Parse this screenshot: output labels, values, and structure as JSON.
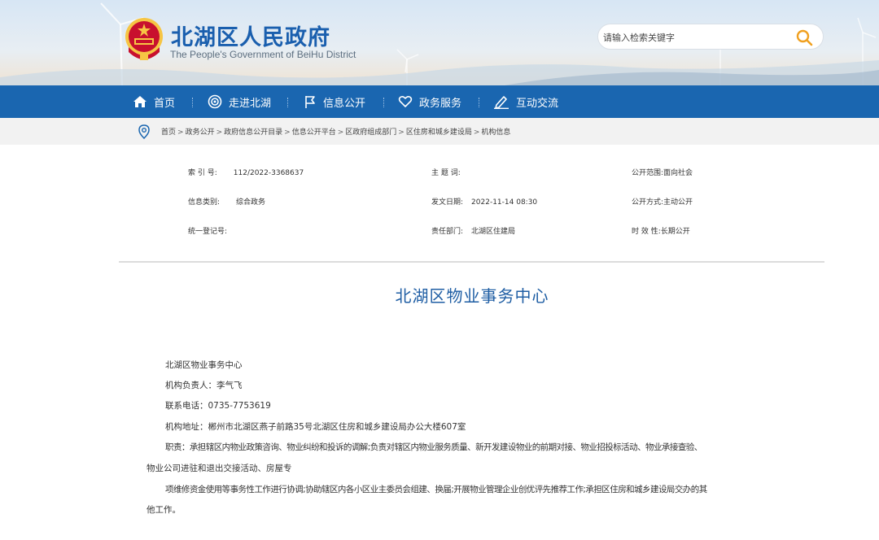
{
  "header": {
    "site_title": "北湖区人民政府",
    "site_subtitle": "The People's Government of BeiHu District",
    "search_placeholder": "请输入检索关键字"
  },
  "nav": {
    "items": [
      {
        "label": "首页",
        "icon": "home-icon"
      },
      {
        "label": "走进北湖",
        "icon": "target-icon"
      },
      {
        "label": "信息公开",
        "icon": "flag-icon"
      },
      {
        "label": "政务服务",
        "icon": "heart-icon"
      },
      {
        "label": "互动交流",
        "icon": "pen-icon"
      }
    ]
  },
  "breadcrumb": {
    "icon": "location-pin-icon",
    "items": [
      "首页",
      "政务公开",
      "政府信息公开目录",
      "信息公开平台",
      "区政府组成部门",
      "区住房和城乡建设局",
      "机构信息"
    ],
    "separator": ">"
  },
  "meta": {
    "index_label": "索  引  号:",
    "index_value": "112/2022-3368637",
    "topic_label": "主  题  词:",
    "topic_value": "",
    "scope_label": "公开范围:",
    "scope_value": "面向社会",
    "category_label": "信息类别:",
    "category_value": "综合政务",
    "date_label": "发文日期:",
    "date_value": "2022-11-14 08:30",
    "mode_label": "公开方式:",
    "mode_value": "主动公开",
    "reg_label": "统一登记号:",
    "reg_value": "",
    "dept_label": "责任部门:",
    "dept_value": "北湖区住建局",
    "validity_label": "时  效  性:",
    "validity_value": "长期公开"
  },
  "article": {
    "title": "北湖区物业事务中心",
    "paragraphs": [
      "北湖区物业事务中心",
      "机构负责人：李气飞",
      "联系电话：0735-7753619",
      "机构地址：郴州市北湖区燕子前路35号北湖区住房和城乡建设局办公大楼607室",
      "职责：承担辖区内物业政策咨询、物业纠纷和投诉的调解;负责对辖区内物业服务质量、新开发建设物业的前期对接、物业招投标活动、物业承接查验、",
      "物业公司进驻和退出交接活动、房屋专",
      "项维修资金使用等事务性工作进行协调;协助辖区内各小区业主委员会组建、换届;开展物业管理企业创优评先推荐工作;承担区住房和城乡建设局交办的其",
      "他工作。"
    ]
  },
  "colors": {
    "brand_blue": "#1a66b0",
    "title_blue": "#1f5ea4",
    "search_orange": "#f0a020",
    "emblem_red": "#c8102e",
    "emblem_gold": "#f6c544"
  }
}
